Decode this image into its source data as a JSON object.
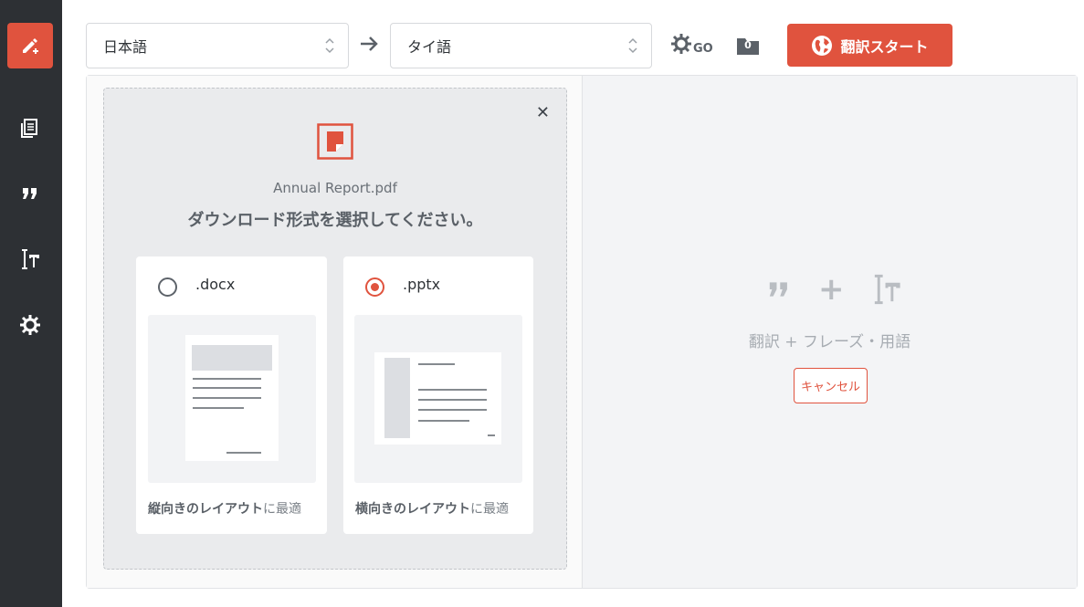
{
  "sidebar": {
    "items": [
      {
        "icon": "edit-icon",
        "active": true
      },
      {
        "icon": "document-icon"
      },
      {
        "icon": "quote-icon"
      },
      {
        "icon": "text-icon"
      },
      {
        "icon": "gear-icon"
      }
    ]
  },
  "toolbar": {
    "source_language": "日本語",
    "target_language": "タイ語",
    "settings_suffix": "GO",
    "folder_count": "0",
    "start_label": "翻訳スタート"
  },
  "upload": {
    "filename": "Annual Report.pdf",
    "prompt": "ダウンロード形式を選択してください。",
    "options": [
      {
        "ext": ".docx",
        "caption_bold": "縦向きのレイアウト",
        "caption_rest": "に最適",
        "selected": false
      },
      {
        "ext": ".pptx",
        "caption_bold": "横向きのレイアウト",
        "caption_rest": "に最適",
        "selected": true
      }
    ]
  },
  "right": {
    "label": "翻訳 + フレーズ・用語",
    "cancel_label": "キャンセル"
  },
  "colors": {
    "accent": "#e0533e",
    "sidebar": "#2d3034"
  }
}
